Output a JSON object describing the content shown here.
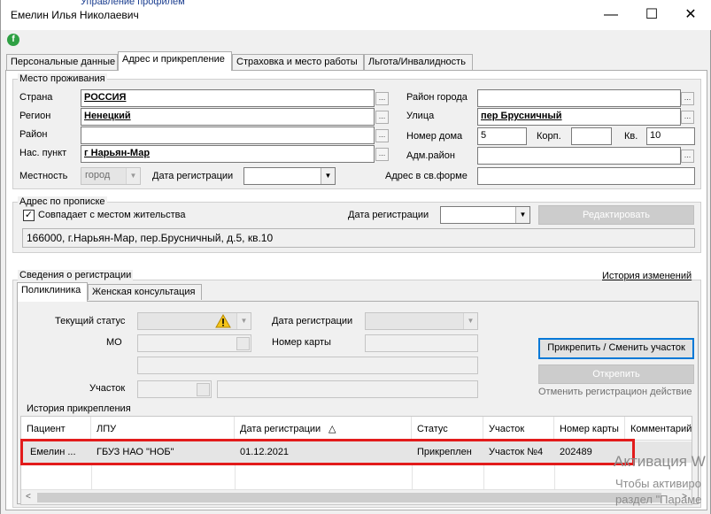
{
  "window": {
    "title": "Емелин Илья Николаевич",
    "background_strip_text": "Управление профилем",
    "controls": {
      "minimize": "—",
      "maximize": "☐",
      "close": "✕"
    }
  },
  "toolbar": {
    "app_icon": "f"
  },
  "tabs": [
    "Персональные данные",
    "Адрес и прикрепление",
    "Страховка и место работы",
    "Льгота/Инвалидность"
  ],
  "residence": {
    "group_title": "Место проживания",
    "country_label": "Страна",
    "country_value": "РОССИЯ",
    "region_label": "Регион",
    "region_value": "Ненецкий",
    "district_label": "Район",
    "district_value": "",
    "settlement_label": "Нас. пункт",
    "settlement_value": "г Нарьян-Мар",
    "locality_label": "Местность",
    "locality_value": "город",
    "reg_date_label": "Дата регистрации",
    "reg_date_value": "",
    "city_district_label": "Район города",
    "city_district_value": "",
    "street_label": "Улица",
    "street_value": "пер Брусничный",
    "house_label": "Номер дома",
    "house_value": "5",
    "building_label": "Корп.",
    "building_value": "",
    "apartment_label": "Кв.",
    "apartment_value": "10",
    "adm_district_label": "Адм.район",
    "adm_district_value": "",
    "free_address_label": "Адрес в св.форме",
    "free_address_value": "",
    "ellipsis": "..."
  },
  "registration_address": {
    "group_title": "Адрес по прописке",
    "same_as_residence_label": "Совпадает с местом жительства",
    "same_as_residence_checked": true,
    "reg_date_label": "Дата регистрации",
    "reg_date_value": "",
    "edit_button": "Редактировать",
    "full_address": "166000, г.Нарьян-Мар, пер.Брусничный, д.5, кв.10"
  },
  "registration_info": {
    "group_title": "Сведения о регистрации",
    "history_link": "История изменений",
    "subtabs": [
      "Поликлиника",
      "Женская консультация"
    ],
    "current_status_label": "Текущий статус",
    "current_status_value": "",
    "reg_date_label": "Дата регистрации",
    "reg_date_value": "",
    "mo_label": "МО",
    "mo_value": "",
    "card_number_label": "Номер карты",
    "card_number_value": "",
    "site_label": "Участок",
    "site_value": "",
    "attach_button": "Прикрепить / Сменить участок",
    "detach_button": "Открепить",
    "cancel_link": "Отменить регистрацион действие"
  },
  "attachment_history": {
    "group_title": "История прикрепления",
    "columns": [
      "Пациент",
      "ЛПУ",
      "Дата регистрации",
      "Статус",
      "Участок",
      "Номер карты",
      "Комментарий"
    ],
    "sort_indicator": "△",
    "rows": [
      [
        "Емелин ...",
        "ГБУЗ НАО \"НОБ\"",
        "01.12.2021",
        "Прикреплен",
        "Участок №4",
        "202489",
        ""
      ]
    ],
    "scroll_left": "<",
    "scroll_right": ">"
  },
  "watermark": {
    "line1": "Активация W",
    "line2": "Чтобы активиро",
    "line3": "раздел \"Параме"
  },
  "colors": {
    "highlight": "#e21b1b",
    "focus": "#0078d7",
    "icon_green": "#2ea043"
  }
}
